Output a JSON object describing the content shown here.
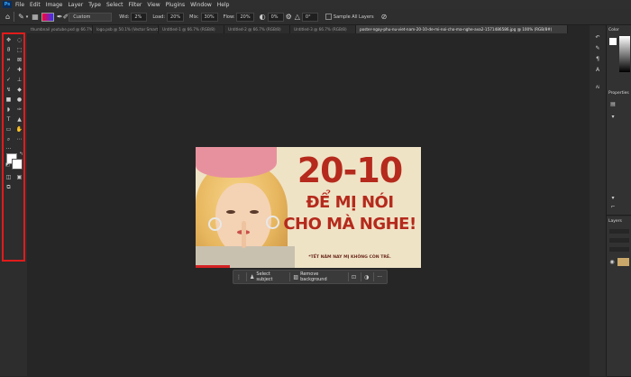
{
  "menu": {
    "logo": "Ps",
    "items": [
      "File",
      "Edit",
      "Image",
      "Layer",
      "Type",
      "Select",
      "Filter",
      "View",
      "Plugins",
      "Window",
      "Help"
    ]
  },
  "options": {
    "preset": "Custom",
    "width_label": "Wid:",
    "width_value": "2%",
    "load_label": "Load:",
    "load_value": "20%",
    "mix_label": "Mix:",
    "mix_value": "30%",
    "flow_label": "Flow:",
    "flow_value": "20%",
    "pct_value": "0%",
    "angle_value": "0°",
    "sample_all_layers": "Sample All Layers"
  },
  "tabs": [
    {
      "label": "thumbnail youtube.psd @ 66.7% (Layer 1, RGB/8)",
      "active": false
    },
    {
      "label": "logo.psb @ 50.1% (Vector Smart...",
      "active": false
    },
    {
      "label": "Untitled-1 @ 66.7% (RGB/8)",
      "active": false
    },
    {
      "label": "Untitled-2 @ 66.7% (RGB/8)",
      "active": false
    },
    {
      "label": "Untitled-3 @ 66.7% (RGB/8)",
      "active": false
    },
    {
      "label": "poster-ngay-phu-nu-viet-nam-20-10-de-mi-noi-cho-ma-nghe-ava2-1571486586.jpg @ 100% (RGB/8#)",
      "active": true
    }
  ],
  "poster": {
    "date": "20-10",
    "line1": "ĐỂ MỊ NÓI",
    "line2": "CHO MÀ NGHE!",
    "tagline": "*TẾT NĂM NAY MỊ KHÔNG CÒN TRẺ."
  },
  "context_bar": {
    "select_subject": "Select subject",
    "remove_background": "Remove background"
  },
  "right_panel": {
    "color_title": "Color",
    "properties_title": "Properties",
    "layers_title": "Layers"
  },
  "colors": {
    "highlight": "#e21b1b",
    "poster_red": "#b52a1c",
    "poster_bg": "#efe3c6"
  }
}
